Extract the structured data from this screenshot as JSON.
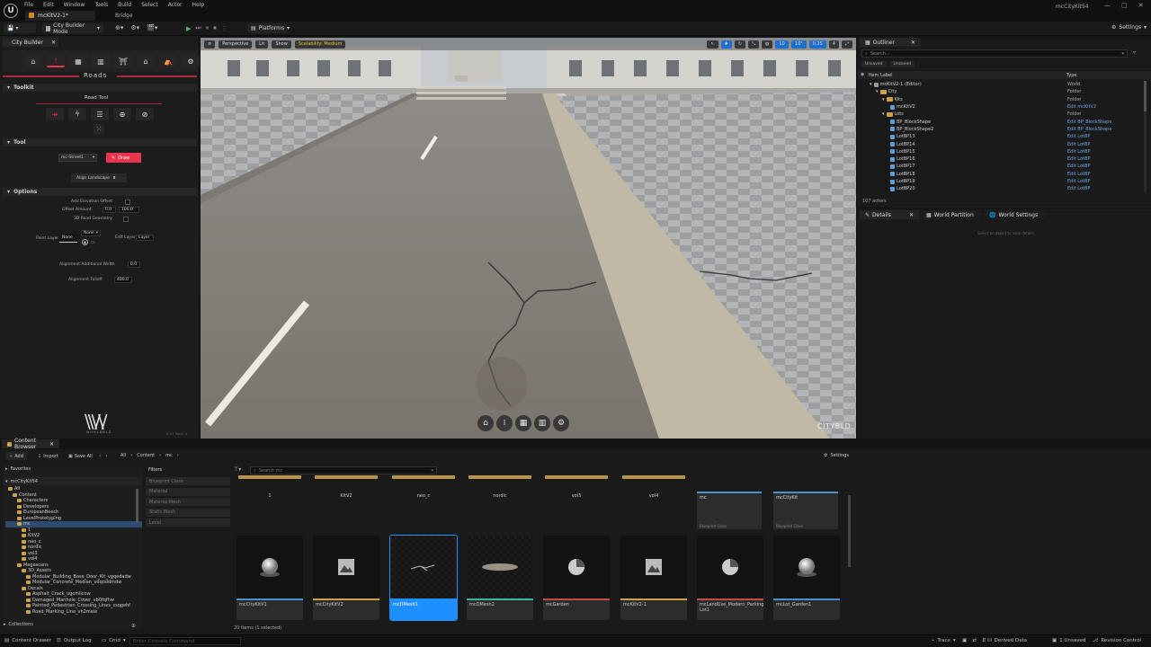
{
  "app": {
    "menu": [
      "File",
      "Edit",
      "Window",
      "Tools",
      "Build",
      "Select",
      "Actor",
      "Help"
    ],
    "doc_tab": "mcKitV2-1*",
    "secondary_tab": "Bridge",
    "project_name": "mcCityKit54",
    "win_controls": [
      "—",
      "▢",
      "✕"
    ]
  },
  "toolbar": {
    "mode": "City Builder Mode",
    "platforms": "Platforms",
    "settings": "Settings"
  },
  "city_builder": {
    "panel_tab": "City Builder",
    "heading": "Roads",
    "toolkit_label": "Toolkit",
    "road_tool_label": "Road Tool",
    "tool_label": "Tool",
    "street_dropdown": "mc-Street1",
    "draw_button": "Draw",
    "align_landscape": "Align Landscape",
    "options_label": "Options",
    "opt_add_elevation": "Add Elevation Offset",
    "opt_offset_amount": "Offset Amount",
    "opt_offset_a": "0.0",
    "opt_offset_b": "100.0",
    "opt_3d_geometry": "3D Road Geometry",
    "paint_layer_label": "Paint Layer",
    "paint_layer_value": "None",
    "paint_layer_dropdown": "None",
    "edit_layer_label": "Edit Layer",
    "edit_layer_value": "Layer",
    "alignment_add_width": "Alignment Additional Width",
    "alignment_add_width_val": "0.0",
    "alignment_falloff": "Alignment Falloff",
    "alignment_falloff_val": "400.0",
    "brand_small": "WORLDBLD",
    "version": "0.2.1 Patch 4"
  },
  "viewport": {
    "perspective": "Perspective",
    "lit": "Lit",
    "show": "Show",
    "scalability": "Scalability: Medium",
    "right_vals": [
      "10",
      "10°",
      "0.25",
      "4"
    ],
    "watermark": "CITYBLD"
  },
  "outliner": {
    "tab": "Outliner",
    "search_placeholder": "Search...",
    "filters": [
      "Unsaved",
      "Unsaved"
    ],
    "col_label": "Item Label",
    "col_type": "Type",
    "rows": [
      {
        "label": "mcKitV2-1 (Editor)",
        "type": "World",
        "indent": 1,
        "kind": "world",
        "link": false
      },
      {
        "label": "City",
        "type": "Folder",
        "indent": 2,
        "kind": "folder",
        "link": false
      },
      {
        "label": "Kits",
        "type": "Folder",
        "indent": 3,
        "kind": "folder",
        "link": false
      },
      {
        "label": "mcKitV2",
        "type": "Edit mcKitV2",
        "indent": 4,
        "kind": "actor",
        "link": true
      },
      {
        "label": "Lots",
        "type": "Folder",
        "indent": 3,
        "kind": "folder",
        "link": false
      },
      {
        "label": "BP_BlockShape",
        "type": "Edit BP_BlockShape",
        "indent": 4,
        "kind": "actor",
        "link": true
      },
      {
        "label": "BP_BlockShape2",
        "type": "Edit BP_BlockShape",
        "indent": 4,
        "kind": "actor",
        "link": true
      },
      {
        "label": "LotBP13",
        "type": "Edit LotBP",
        "indent": 4,
        "kind": "actor",
        "link": true
      },
      {
        "label": "LotBP14",
        "type": "Edit LotBP",
        "indent": 4,
        "kind": "actor",
        "link": true
      },
      {
        "label": "LotBP15",
        "type": "Edit LotBP",
        "indent": 4,
        "kind": "actor",
        "link": true
      },
      {
        "label": "LotBP16",
        "type": "Edit LotBP",
        "indent": 4,
        "kind": "actor",
        "link": true
      },
      {
        "label": "LotBP17",
        "type": "Edit LotBP",
        "indent": 4,
        "kind": "actor",
        "link": true
      },
      {
        "label": "LotBP18",
        "type": "Edit LotBP",
        "indent": 4,
        "kind": "actor",
        "link": true
      },
      {
        "label": "LotBP19",
        "type": "Edit LotBP",
        "indent": 4,
        "kind": "actor",
        "link": true
      },
      {
        "label": "LotBP20",
        "type": "Edit LotBP",
        "indent": 4,
        "kind": "actor",
        "link": true
      }
    ],
    "actor_count": "107 actors"
  },
  "details": {
    "tabs": [
      "Details",
      "World Partition",
      "World Settings"
    ],
    "empty_msg": "Select an object to view details."
  },
  "content_browser": {
    "tab": "Content Browser",
    "add": "Add",
    "import": "Import",
    "save_all": "Save All",
    "path": [
      "All",
      "Content",
      "mc"
    ],
    "settings": "Settings",
    "favorites": "Favorites",
    "root": "mcCityKit54",
    "filters_label": "Filters",
    "filter_items": [
      "Blueprint Class",
      "Material",
      "Material Mesh",
      "Static Mesh",
      "Level"
    ],
    "search_placeholder": "Search mc",
    "tree": [
      {
        "label": "All",
        "indent": 0,
        "sel": false
      },
      {
        "label": "Content",
        "indent": 1,
        "sel": false
      },
      {
        "label": "Characters",
        "indent": 2,
        "sel": false
      },
      {
        "label": "Developers",
        "indent": 2,
        "sel": false
      },
      {
        "label": "EuropeanBeech",
        "indent": 2,
        "sel": false
      },
      {
        "label": "LevelPrototyping",
        "indent": 2,
        "sel": false
      },
      {
        "label": "mc",
        "indent": 2,
        "sel": true
      },
      {
        "label": "1",
        "indent": 3,
        "sel": false
      },
      {
        "label": "KitV2",
        "indent": 3,
        "sel": false
      },
      {
        "label": "neo_c",
        "indent": 3,
        "sel": false
      },
      {
        "label": "nordic",
        "indent": 3,
        "sel": false
      },
      {
        "label": "vol3",
        "indent": 3,
        "sel": false
      },
      {
        "label": "vol4",
        "indent": 3,
        "sel": false
      },
      {
        "label": "Megascans",
        "indent": 2,
        "sel": false
      },
      {
        "label": "3D_Assets",
        "indent": 3,
        "sel": false
      },
      {
        "label": "Modular_Building_Base_Door_Kit_vgqedadw",
        "indent": 4,
        "sel": false
      },
      {
        "label": "Modular_Concrete_Median_vdqoddmdw",
        "indent": 4,
        "sel": false
      },
      {
        "label": "Decals",
        "indent": 3,
        "sel": false
      },
      {
        "label": "Asphalt_Crack_ugcmlicow",
        "indent": 4,
        "sel": false
      },
      {
        "label": "Damaged_Manhole_Cover_vb0fqfhw",
        "indent": 4,
        "sel": false
      },
      {
        "label": "Painted_Pedestrian_Crossing_Lines_ssqgehf",
        "indent": 4,
        "sel": false
      },
      {
        "label": "Road_Marking_Line_vh2meie",
        "indent": 4,
        "sel": false
      }
    ],
    "folders": [
      "1",
      "KitV2",
      "neo_c",
      "nordic",
      "vol3",
      "vol4"
    ],
    "blueprints": [
      {
        "name": "mc",
        "sub": "Blueprint Class"
      },
      {
        "name": "mcCityKit",
        "sub": "Blueprint Class"
      }
    ],
    "assets": [
      {
        "name": "mcCityKitV1",
        "thumb": "sphere",
        "bar": "#4a8fd6",
        "selected": false
      },
      {
        "name": "mcCityKitV2",
        "thumb": "picture",
        "bar": "#c9a24a",
        "selected": false
      },
      {
        "name": "mcDMesh1",
        "thumb": "crack",
        "bar": "#1e8fff",
        "selected": true
      },
      {
        "name": "mcDMesh2",
        "thumb": "puddle",
        "bar": "#3ab3a0",
        "selected": false
      },
      {
        "name": "mcGarden",
        "thumb": "pie",
        "bar": "#c04a4a",
        "selected": false
      },
      {
        "name": "mcKitV2-1",
        "thumb": "picture",
        "bar": "#c9a24a",
        "selected": false
      },
      {
        "name": "mcLandUse_Modern_Parking Lot1",
        "thumb": "pie",
        "bar": "#c04a4a",
        "selected": false
      },
      {
        "name": "mcLot_Garden1",
        "thumb": "sphere",
        "bar": "#4a8fd6",
        "selected": false
      }
    ],
    "item_count": "20 items (1 selected)",
    "collections": "Collections"
  },
  "status": {
    "content_drawer": "Content Drawer",
    "output_log": "Output Log",
    "cmd": "Cmd",
    "console_placeholder": "Enter Console Command",
    "trace": "Trace",
    "derived_data": "Derived Data",
    "unsaved": "1 Unsaved",
    "revision_control": "Revision Control"
  },
  "colors": {
    "accent_red": "#e8344e",
    "selection_blue": "#1e8fff",
    "folder_gold": "#c9a24a"
  }
}
